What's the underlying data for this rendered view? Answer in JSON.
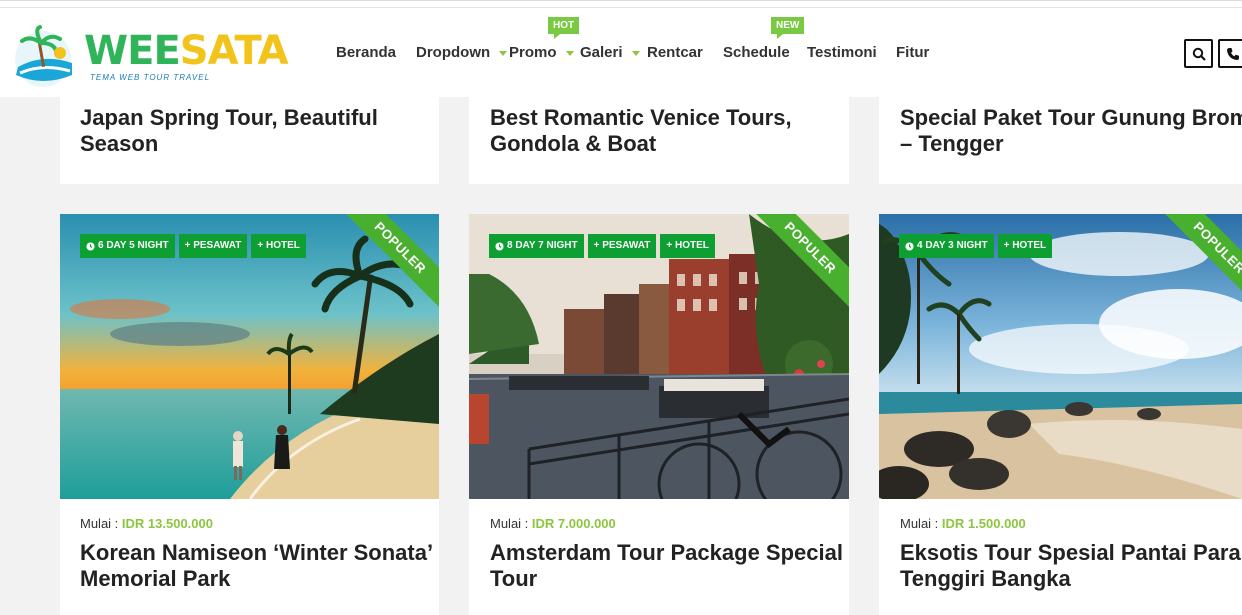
{
  "header": {
    "logo_text_a": "WEE",
    "logo_text_b": "SATA",
    "tagline": "TEMA WEB TOUR TRAVEL",
    "nav": [
      {
        "label": "Beranda"
      },
      {
        "label": "Dropdown"
      },
      {
        "label": "Promo",
        "badge": "HOT"
      },
      {
        "label": "Galeri"
      },
      {
        "label": "Rentcar"
      },
      {
        "label": "Schedule",
        "badge": "NEW"
      },
      {
        "label": "Testimoni"
      },
      {
        "label": "Fitur"
      }
    ],
    "icons": [
      "search-icon",
      "phone-icon"
    ]
  },
  "top_cards": [
    {
      "title_line1": "Japan Spring Tour, Beautiful",
      "title_line2": "Season"
    },
    {
      "title_line1": "Best Romantic Venice Tours,",
      "title_line2": "Gondola & Boat"
    },
    {
      "title_line1": "Special Paket Tour Gunung Bromo",
      "title_line2": "– Tengger"
    }
  ],
  "tours": [
    {
      "duration": "6 DAY 5 NIGHT",
      "plane": "+ PESAWAT",
      "hotel": "+ HOTEL",
      "ribbon": "POPULER",
      "price_label": "Mulai :",
      "price": "IDR 13.500.000",
      "title_line1": "Korean Namiseon ‘Winter Sonata’",
      "title_line2": "Memorial Park"
    },
    {
      "duration": "8 DAY 7 NIGHT",
      "plane": "+ PESAWAT",
      "hotel": "+ HOTEL",
      "ribbon": "POPULER",
      "price_label": "Mulai :",
      "price": "IDR 7.000.000",
      "title_line1": "Amsterdam Tour Package Special",
      "title_line2": "Tour"
    },
    {
      "duration": "4 DAY 3 NIGHT",
      "hotel": "+ HOTEL",
      "ribbon": "POPULER",
      "price_label": "Mulai :",
      "price": "IDR 1.500.000",
      "title_line1": "Eksotis Tour Spesial Pantai Parai",
      "title_line2": "Tenggiri Bangka"
    }
  ],
  "colors": {
    "accent_green": "#0e9f32",
    "ribbon_green": "#48b02e",
    "price_green": "#8cc63f"
  }
}
